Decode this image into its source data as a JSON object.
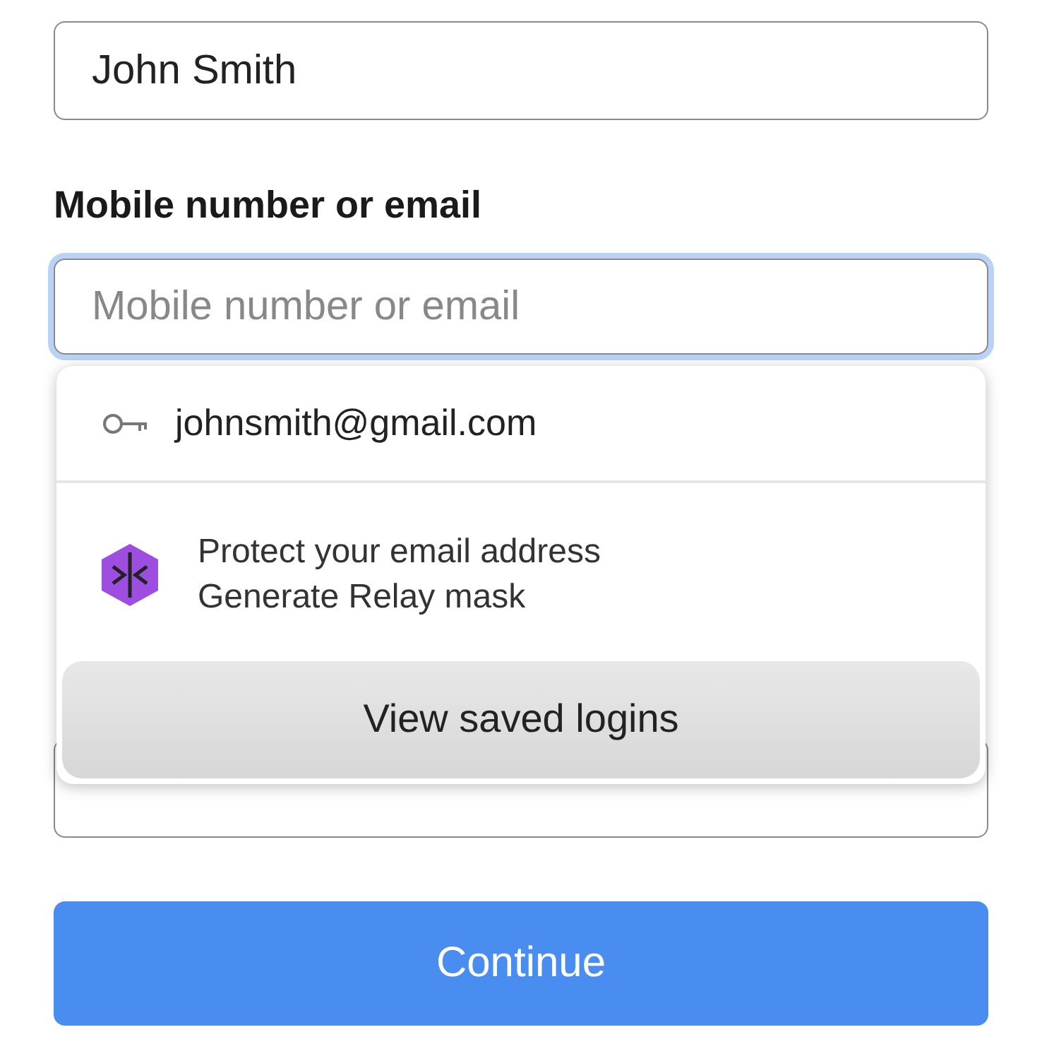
{
  "name_field": {
    "value": "John Smith"
  },
  "contact_label": "Mobile number or email",
  "contact_field": {
    "placeholder": "Mobile number or email",
    "focused": true
  },
  "autofill_popup": {
    "saved_login": "johnsmith@gmail.com",
    "relay": {
      "title": "Protect your email address",
      "subtitle": "Generate Relay mask"
    },
    "view_button": "View saved logins"
  },
  "continue_button": "Continue"
}
